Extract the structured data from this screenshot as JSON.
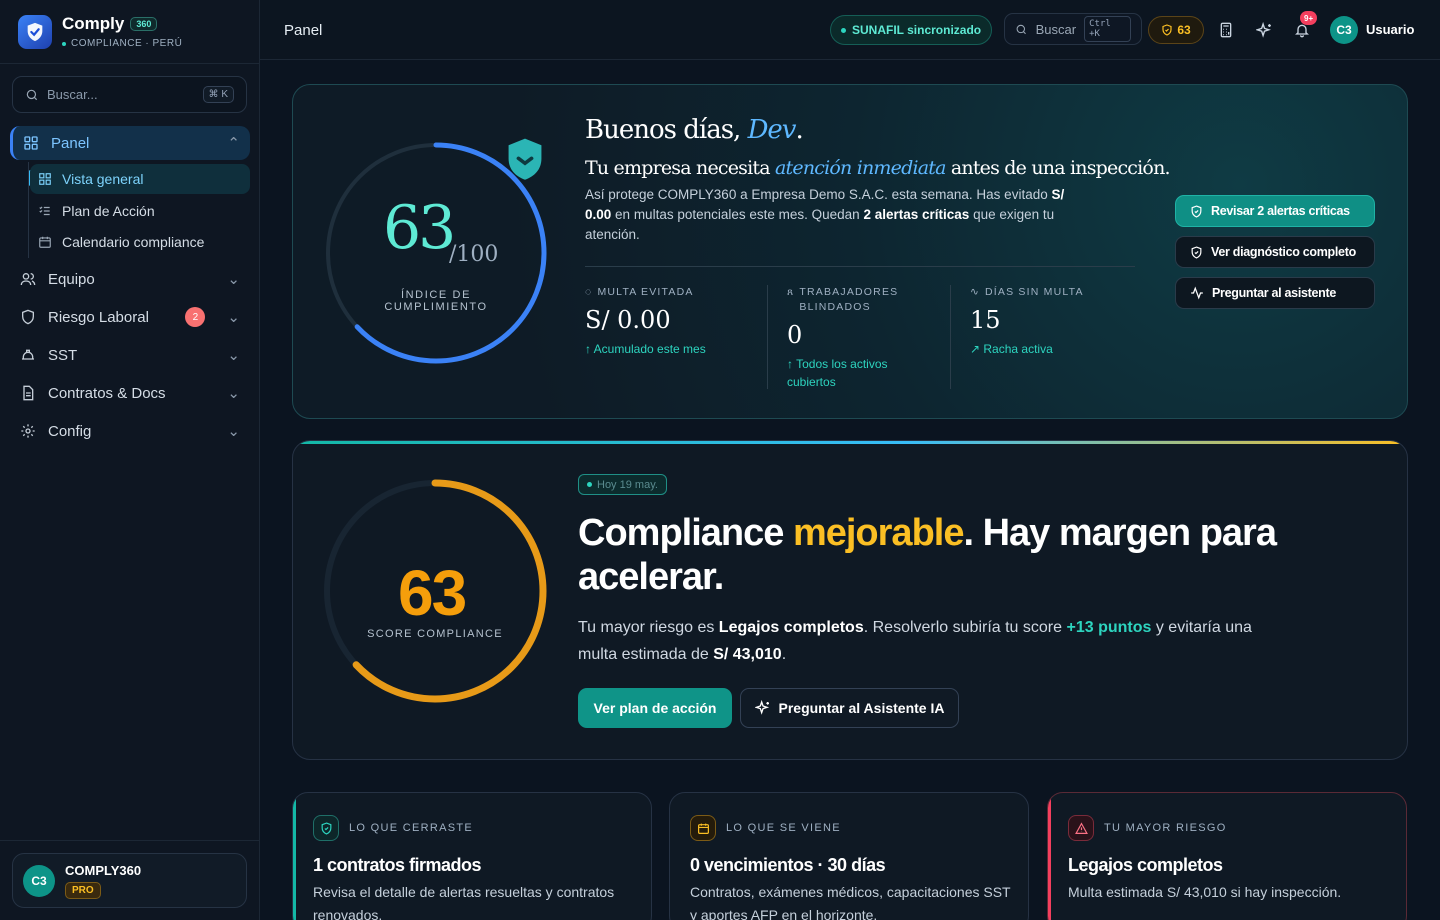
{
  "brand": {
    "name": "Comply",
    "badge": "360",
    "subtitle": "COMPLIANCE · PERÚ"
  },
  "sidebar": {
    "search_placeholder": "Buscar...",
    "search_shortcut": "⌘ K",
    "items": [
      {
        "label": "Panel",
        "icon": "grid-icon",
        "active": true
      },
      {
        "label": "Equipo",
        "icon": "users-icon"
      },
      {
        "label": "Riesgo Laboral",
        "icon": "shield-icon",
        "badge": "2"
      },
      {
        "label": "SST",
        "icon": "hardhat-icon"
      },
      {
        "label": "Contratos & Docs",
        "icon": "document-icon"
      },
      {
        "label": "Config",
        "icon": "gear-icon"
      }
    ],
    "subitems": [
      {
        "label": "Vista general",
        "active": true
      },
      {
        "label": "Plan de Acción"
      },
      {
        "label": "Calendario compliance"
      }
    ],
    "plan": {
      "avatar": "C3",
      "name": "COMPLY360",
      "tier": "PRO"
    }
  },
  "topbar": {
    "title": "Panel",
    "sync_status": "SUNAFIL sincronizado",
    "search_label": "Buscar",
    "search_shortcut": "Ctrl +K",
    "score": "63",
    "notifications": "9+",
    "avatar": "C3",
    "user": "Usuario"
  },
  "hero": {
    "score": "63",
    "score_max": "/100",
    "score_label": "ÍNDICE DE CUMPLIMIENTO",
    "score_fraction": 0.63,
    "greeting_prefix": "Buenos días,",
    "greeting_name": "Dev",
    "greeting_suffix": ".",
    "need_prefix": "Tu empresa necesita",
    "need_emph": "atención inmediata",
    "need_suffix": "antes de una inspección.",
    "desc_1": "Así protege COMPLY360 a Empresa Demo S.A.C. esta semana. Has evitado",
    "desc_amount": "S/ 0.00",
    "desc_2": "en multas potenciales este mes. Quedan",
    "desc_alerts": "2 alertas críticas",
    "desc_3": "que exigen tu atención.",
    "stats": [
      {
        "label": "MULTA EVITADA",
        "value": "S/ 0.00",
        "note": "Acumulado este mes"
      },
      {
        "label": "TRABAJADORES BLINDADOS",
        "value": "0",
        "note": "Todos los activos cubiertos"
      },
      {
        "label": "DÍAS SIN MULTA",
        "value": "15",
        "note": "Racha activa"
      }
    ],
    "actions": [
      "Revisar 2 alertas críticas",
      "Ver diagnóstico completo",
      "Preguntar al asistente"
    ]
  },
  "compliance": {
    "score": "63",
    "score_label": "SCORE COMPLIANCE",
    "score_fraction": 0.63,
    "date_chip": "Hoy 19 may.",
    "headline_1": "Compliance",
    "headline_emph": "mejorable",
    "headline_2": ". Hay margen para acelerar.",
    "desc_1": "Tu mayor riesgo es",
    "desc_risk": "Legajos completos",
    "desc_2": ". Resolverlo subiría tu score",
    "desc_points": "+13 puntos",
    "desc_3": "y evitaría una multa estimada de",
    "desc_fine": "S/ 43,010",
    "desc_4": ".",
    "primary_button": "Ver plan de acción",
    "secondary_button": "Preguntar al Asistente IA"
  },
  "cards": [
    {
      "kicker": "LO QUE CERRASTE",
      "title": "1 contratos firmados",
      "desc": "Revisa el detalle de alertas resueltas y contratos renovados.",
      "accent": "#14b8a6",
      "icon": "shield-check-icon"
    },
    {
      "kicker": "LO QUE SE VIENE",
      "title": "0 vencimientos · 30 días",
      "desc": "Contratos, exámenes médicos, capacitaciones SST y aportes AFP en el horizonte.",
      "accent": "#f59e0b",
      "icon": "calendar-icon"
    },
    {
      "kicker": "TU MAYOR RIESGO",
      "title": "Legajos completos",
      "desc": "Multa estimada S/ 43,010 si hay inspección.",
      "accent": "#f43f5e",
      "icon": "alert-icon"
    }
  ],
  "colors": {
    "teal": "#14b8a6",
    "blue": "#3b82f6",
    "amber": "#f59e0b",
    "danger": "#f43f5e",
    "background": "#0b1420"
  }
}
